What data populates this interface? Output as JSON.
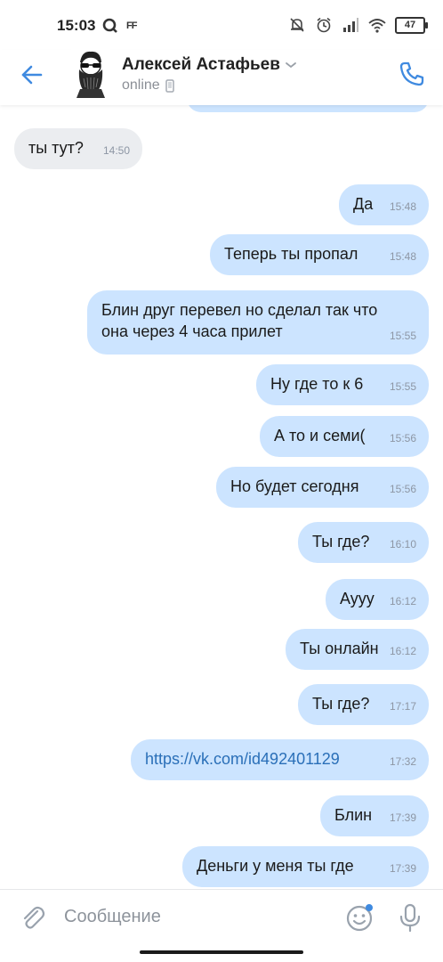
{
  "status_bar": {
    "time": "15:03",
    "left_icons": [
      "q-app-icon",
      "ff-app-icon"
    ],
    "ff_label": "FF",
    "right_icons": [
      "mute-icon",
      "alarm-icon",
      "signal-icon",
      "wifi-icon"
    ],
    "battery": "47"
  },
  "header": {
    "contact_name": "Алексей Астафьев",
    "status": "online",
    "accent_color": "#3f8ae0"
  },
  "messages": [
    {
      "dir": "out",
      "text": "",
      "time": ""
    },
    {
      "dir": "in",
      "text": "ты тут?",
      "time": "14:50"
    },
    {
      "dir": "out",
      "text": "Да",
      "time": "15:48"
    },
    {
      "dir": "out",
      "text": "Теперь ты пропал",
      "time": "15:48"
    },
    {
      "dir": "out",
      "line1": "Блин друг перевел но сделал так что",
      "line2": "она через 4 часа прилет",
      "time": "15:55"
    },
    {
      "dir": "out",
      "text": "Ну где то к 6",
      "time": "15:55"
    },
    {
      "dir": "out",
      "text": "А то и семи(",
      "time": "15:56"
    },
    {
      "dir": "out",
      "text": "Но будет сегодня",
      "time": "15:56"
    },
    {
      "dir": "out",
      "text": "Ты где?",
      "time": "16:10"
    },
    {
      "dir": "out",
      "text": "Аууу",
      "time": "16:12"
    },
    {
      "dir": "out",
      "text": "Ты онлайн",
      "time": "16:12"
    },
    {
      "dir": "out",
      "text": "Ты где?",
      "time": "17:17"
    },
    {
      "dir": "out",
      "text": "https://vk.com/id492401129",
      "time": "17:32",
      "is_link": true
    },
    {
      "dir": "out",
      "text": "Блин",
      "time": "17:39"
    },
    {
      "dir": "out",
      "text": "Деньги у меня ты где",
      "time": "17:39"
    }
  ],
  "composer": {
    "placeholder": "Сообщение"
  },
  "colors": {
    "outgoing_bubble": "#cce4ff",
    "incoming_bubble": "#ebedf0",
    "link": "#2a6fb8"
  }
}
